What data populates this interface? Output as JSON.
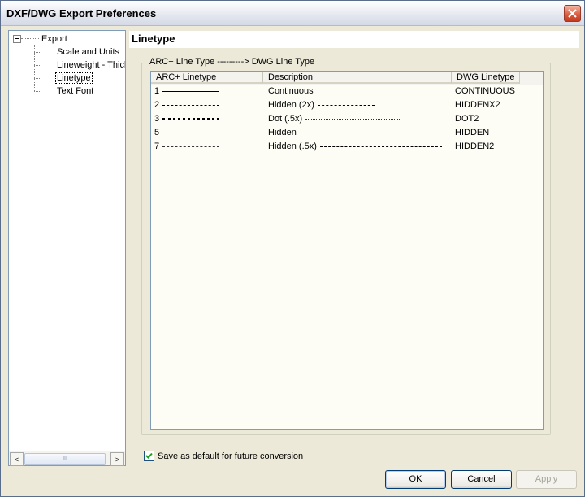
{
  "window": {
    "title": "DXF/DWG Export Preferences"
  },
  "tree": {
    "items": [
      {
        "label": "Export"
      },
      {
        "label": "Scale and Units"
      },
      {
        "label": "Lineweight - Thickness"
      },
      {
        "label": "Linetype"
      },
      {
        "label": "Text Font"
      }
    ],
    "scroll_left": "<",
    "scroll_right": ">",
    "thumb_grip": "III"
  },
  "panel": {
    "title": "Linetype",
    "group_label": "ARC+ Line Type ---------> DWG Line Type"
  },
  "table": {
    "columns": [
      "ARC+ Linetype",
      "Description",
      "DWG Linetype"
    ],
    "rows": [
      {
        "num": "1",
        "style": "solid",
        "description": "Continuous",
        "desc_sample": "none",
        "dwg": "CONTINUOUS"
      },
      {
        "num": "2",
        "style": "dash-long",
        "description": "Hidden (2x)",
        "desc_sample": "dash-long",
        "dwg": "HIDDENX2"
      },
      {
        "num": "3",
        "style": "dot-big",
        "description": "Dot (.5x)",
        "desc_sample": "dot-fine",
        "dwg": "DOT2"
      },
      {
        "num": "5",
        "style": "dash-fine",
        "description": "Hidden",
        "desc_sample": "dash-mid",
        "dwg": "HIDDEN"
      },
      {
        "num": "7",
        "style": "dash-short",
        "description": "Hidden (.5x)",
        "desc_sample": "dash-small",
        "dwg": "HIDDEN2"
      }
    ]
  },
  "options": {
    "save_default_label": "Save as default for future conversion",
    "save_default_checked": true
  },
  "buttons": {
    "ok": "OK",
    "cancel": "Cancel",
    "apply": "Apply"
  }
}
